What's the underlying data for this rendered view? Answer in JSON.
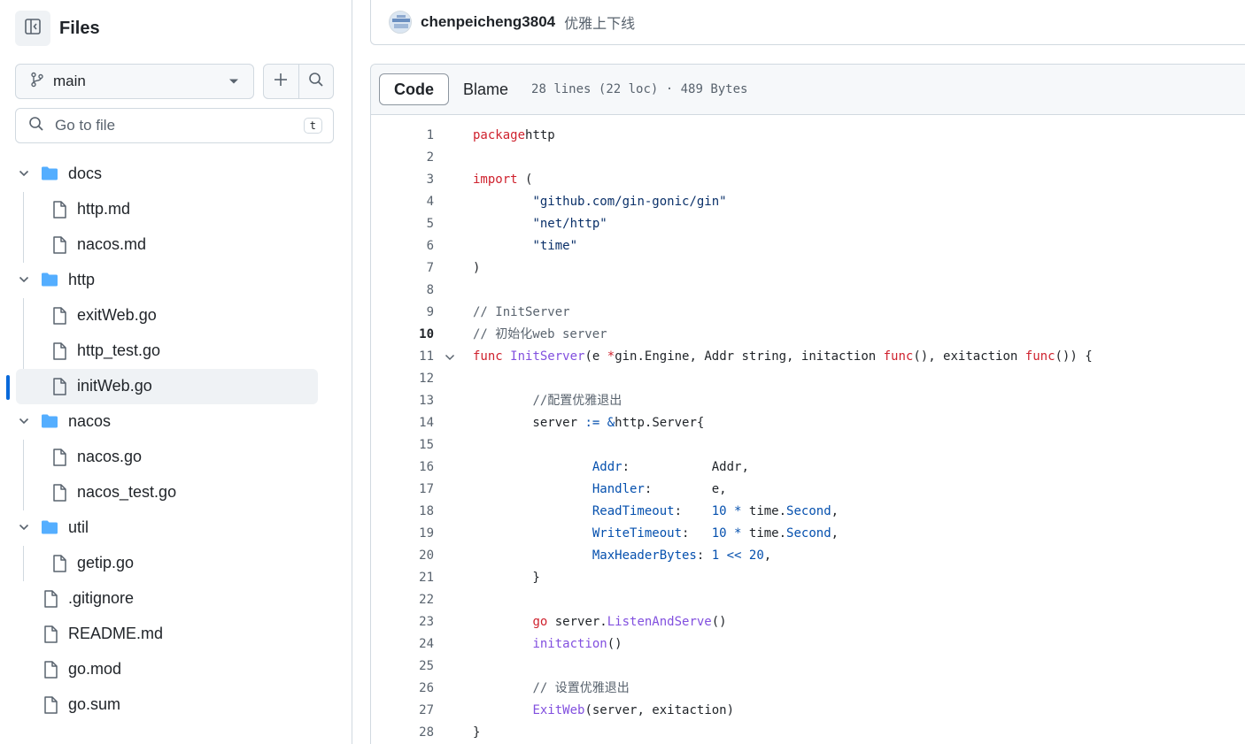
{
  "sidebar": {
    "title": "Files",
    "branch": "main",
    "search_placeholder": "Go to file",
    "search_shortcut": "t",
    "tree": [
      {
        "label": "docs",
        "type": "folder",
        "depth": 0
      },
      {
        "label": "http.md",
        "type": "file",
        "depth": 1
      },
      {
        "label": "nacos.md",
        "type": "file",
        "depth": 1
      },
      {
        "label": "http",
        "type": "folder",
        "depth": 0
      },
      {
        "label": "exitWeb.go",
        "type": "file",
        "depth": 1
      },
      {
        "label": "http_test.go",
        "type": "file",
        "depth": 1
      },
      {
        "label": "initWeb.go",
        "type": "file",
        "depth": 1,
        "selected": true
      },
      {
        "label": "nacos",
        "type": "folder",
        "depth": 0
      },
      {
        "label": "nacos.go",
        "type": "file",
        "depth": 1
      },
      {
        "label": "nacos_test.go",
        "type": "file",
        "depth": 1
      },
      {
        "label": "util",
        "type": "folder",
        "depth": 0
      },
      {
        "label": "getip.go",
        "type": "file",
        "depth": 1
      },
      {
        "label": ".gitignore",
        "type": "file",
        "depth": 0
      },
      {
        "label": "README.md",
        "type": "file",
        "depth": 0
      },
      {
        "label": "go.mod",
        "type": "file",
        "depth": 0
      },
      {
        "label": "go.sum",
        "type": "file",
        "depth": 0
      }
    ]
  },
  "commit": {
    "user": "chenpeicheng3804",
    "message": "优雅上下线"
  },
  "viewer": {
    "tab_code": "Code",
    "tab_blame": "Blame",
    "file_info": "28 lines (22 loc) · 489 Bytes",
    "current_line": 10,
    "fold_line": 11
  },
  "code_lines": [
    [
      [
        "k",
        "package"
      ],
      [
        "",
        "http"
      ]
    ],
    [],
    [
      [
        "k",
        "import"
      ],
      [
        "",
        " ("
      ]
    ],
    [
      [
        "",
        "        "
      ],
      [
        "s",
        "\"github.com/gin-gonic/gin\""
      ]
    ],
    [
      [
        "",
        "        "
      ],
      [
        "s",
        "\"net/http\""
      ]
    ],
    [
      [
        "",
        "        "
      ],
      [
        "s",
        "\"time\""
      ]
    ],
    [
      [
        "",
        ")"
      ]
    ],
    [],
    [
      [
        "c",
        "// InitServer"
      ]
    ],
    [
      [
        "c",
        "// 初始化web server"
      ]
    ],
    [
      [
        "k",
        "func"
      ],
      [
        "",
        " "
      ],
      [
        "f",
        "InitServer"
      ],
      [
        "",
        "(e "
      ],
      [
        "k",
        "*"
      ],
      [
        "",
        "gin.Engine, Addr string, initaction "
      ],
      [
        "k",
        "func"
      ],
      [
        "",
        "(), exitaction "
      ],
      [
        "k",
        "func"
      ],
      [
        "",
        "()) {"
      ]
    ],
    [],
    [
      [
        "",
        "        "
      ],
      [
        "c",
        "//配置优雅退出"
      ]
    ],
    [
      [
        "",
        "        server "
      ],
      [
        "n",
        ":="
      ],
      [
        "",
        " "
      ],
      [
        "n",
        "&"
      ],
      [
        "",
        "http.Server{"
      ]
    ],
    [],
    [
      [
        "",
        "                "
      ],
      [
        "n",
        "Addr"
      ],
      [
        "",
        ":           Addr,"
      ]
    ],
    [
      [
        "",
        "                "
      ],
      [
        "n",
        "Handler"
      ],
      [
        "",
        ":        e,"
      ]
    ],
    [
      [
        "",
        "                "
      ],
      [
        "n",
        "ReadTimeout"
      ],
      [
        "",
        ":    "
      ],
      [
        "n",
        "10"
      ],
      [
        "",
        " "
      ],
      [
        "n",
        "*"
      ],
      [
        "",
        " time."
      ],
      [
        "n",
        "Second"
      ],
      [
        "",
        ","
      ]
    ],
    [
      [
        "",
        "                "
      ],
      [
        "n",
        "WriteTimeout"
      ],
      [
        "",
        ":   "
      ],
      [
        "n",
        "10"
      ],
      [
        "",
        " "
      ],
      [
        "n",
        "*"
      ],
      [
        "",
        " time."
      ],
      [
        "n",
        "Second"
      ],
      [
        "",
        ","
      ]
    ],
    [
      [
        "",
        "                "
      ],
      [
        "n",
        "MaxHeaderBytes"
      ],
      [
        "",
        ": "
      ],
      [
        "n",
        "1"
      ],
      [
        "",
        " "
      ],
      [
        "n",
        "<<"
      ],
      [
        "",
        " "
      ],
      [
        "n",
        "20"
      ],
      [
        "",
        ","
      ]
    ],
    [
      [
        "",
        "        }"
      ]
    ],
    [],
    [
      [
        "",
        "        "
      ],
      [
        "k",
        "go"
      ],
      [
        "",
        " server."
      ],
      [
        "f",
        "ListenAndServe"
      ],
      [
        "",
        "()"
      ]
    ],
    [
      [
        "",
        "        "
      ],
      [
        "f",
        "initaction"
      ],
      [
        "",
        "()"
      ]
    ],
    [],
    [
      [
        "",
        "        "
      ],
      [
        "c",
        "// 设置优雅退出"
      ]
    ],
    [
      [
        "",
        "        "
      ],
      [
        "f",
        "ExitWeb"
      ],
      [
        "",
        "(server, exitaction)"
      ]
    ],
    [
      [
        "",
        "}"
      ]
    ]
  ]
}
